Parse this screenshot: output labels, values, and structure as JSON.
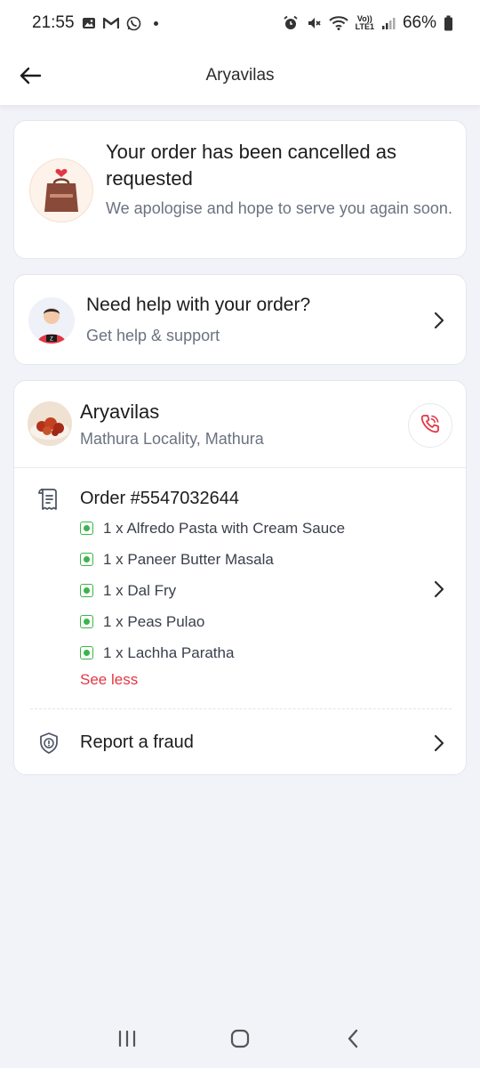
{
  "status_bar": {
    "time": "21:55",
    "battery": "66%",
    "network": "LTE1",
    "volte": "Vo))",
    "icons_left": [
      "gallery-icon",
      "gmail-icon",
      "whatsapp-icon"
    ],
    "icons_right": [
      "alarm-icon",
      "mute-icon",
      "wifi-icon",
      "signal-icon",
      "battery-icon"
    ]
  },
  "header": {
    "title": "Aryavilas"
  },
  "cancel_card": {
    "title": "Your order has been cancelled as requested",
    "subtitle": "We apologise and hope to serve you again soon.",
    "bag_label": "zomato"
  },
  "help_card": {
    "title": "Need help with your order?",
    "subtitle": "Get help & support"
  },
  "order_card": {
    "restaurant_name": "Aryavilas",
    "restaurant_location": "Mathura Locality, Mathura",
    "order_id": "Order #5547032644",
    "items": [
      "1 x Alfredo Pasta with Cream Sauce",
      "1 x Paneer Butter Masala",
      "1 x Dal Fry",
      "1 x Peas Pulao",
      "1 x Lachha Paratha"
    ],
    "see_less": "See less",
    "report_fraud": "Report a fraud"
  },
  "colors": {
    "accent_red": "#e23744",
    "veg_green": "#3bb54a",
    "background": "#f2f3f8"
  }
}
